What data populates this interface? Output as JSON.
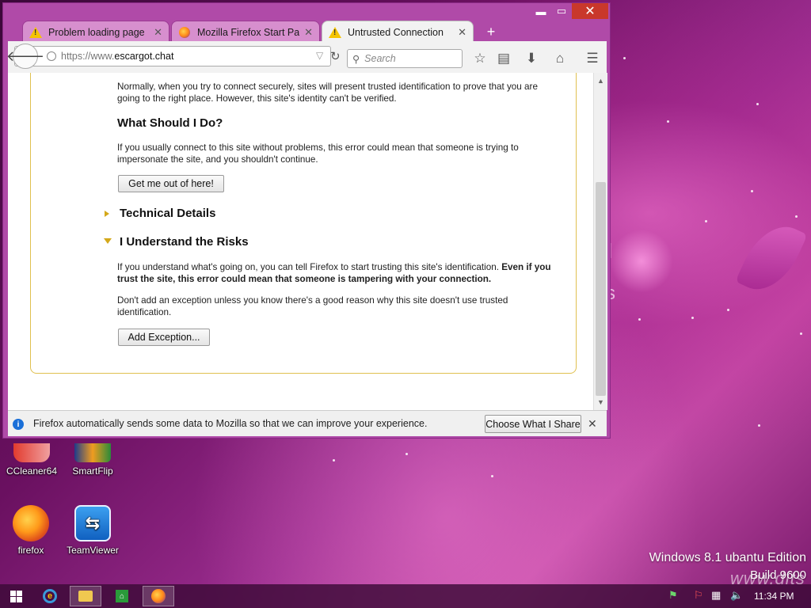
{
  "window": {
    "minimize_glyph": "▬",
    "maximize_glyph": "▭",
    "close_glyph": "✕"
  },
  "tabs": [
    {
      "label": "Problem loading page",
      "icon": "warning-icon",
      "close": "✕",
      "active": false
    },
    {
      "label": "Mozilla Firefox Start Pa...",
      "icon": "firefox-icon",
      "close": "✕",
      "active": false
    },
    {
      "label": "Untrusted Connection",
      "icon": "warning-icon",
      "close": "✕",
      "active": true
    }
  ],
  "newtab_glyph": "+",
  "navbar": {
    "back_glyph": "🡐",
    "url_prefix": "https://www.",
    "url_domain": "escargot.chat",
    "dropdown_glyph": "▽",
    "reload_glyph": "↻",
    "search_placeholder": "Search",
    "search_glyph": "⚲",
    "icons": [
      "bookmark-star-icon",
      "reading-list-icon",
      "download-icon",
      "home-icon",
      "menu-icon"
    ],
    "bookmark_glyph": "☆",
    "reading_glyph": "▤",
    "download_glyph": "⬇",
    "home_glyph": "⌂",
    "menu_glyph": "☰"
  },
  "page": {
    "intro": "Normally, when you try to connect securely, sites will present trusted identification to prove that you are going to the right place. However, this site's identity can't be verified.",
    "heading_do": "What Should I Do?",
    "do_text": "If you usually connect to this site without problems, this error could mean that someone is trying to impersonate the site, and you shouldn't continue.",
    "get_out_button": "Get me out of here!",
    "technical_details": "Technical Details",
    "understand_risks": "I Understand the Risks",
    "risks_text_plain": "If you understand what's going on, you can tell Firefox to start trusting this site's identification.",
    "risks_text_bold": "Even if you trust the site, this error could mean that someone is tampering with your connection.",
    "exception_text": "Don't add an exception unless you know there's a good reason why this site doesn't use trusted identification.",
    "add_exception_button": "Add Exception..."
  },
  "notification": {
    "text": "Firefox automatically sends some data to Mozilla so that we can improve your experience.",
    "button": "Choose What I Share",
    "close": "✕"
  },
  "desktop": {
    "icons": [
      {
        "label": "CCleaner64"
      },
      {
        "label": "SmartFlip"
      },
      {
        "label": "firefox"
      },
      {
        "label": "TeamViewer"
      }
    ],
    "watermark_line1": "Windows 8.1 ubantu Edition",
    "watermark_line2": "Build 9600",
    "watermark_site": "www.dits"
  },
  "taskbar": {
    "clock": "11:34 PM",
    "tray_icons": [
      "action-center-icon",
      "flag-icon",
      "network-icon",
      "volume-muted-icon"
    ]
  },
  "colors": {
    "accent": "#b04aa8",
    "close_red": "#c9382b",
    "warning_yellow": "#f5c400",
    "info_blue": "#1a6fd8"
  }
}
